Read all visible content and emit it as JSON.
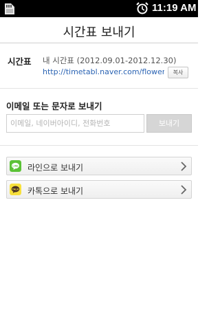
{
  "status_bar": {
    "time": "11:19 AM"
  },
  "header": {
    "title": "시간표 보내기"
  },
  "timetable": {
    "label": "시간표",
    "name": "내 시간표 (2012.09.01-2012.12.30)",
    "url": "http://timetabl.naver.com/flower",
    "copy_label": "복사"
  },
  "send": {
    "heading": "이메일 또는 문자로 보내기",
    "placeholder": "이메일, 네이버아이디, 전화번호",
    "value": "",
    "button_label": "보내기"
  },
  "share": {
    "items": [
      {
        "label": "라인으로 보내기",
        "icon": "line-app-icon",
        "icon_color": "#5bc236"
      },
      {
        "label": "카톡으로 보내기",
        "icon": "kakaotalk-icon",
        "icon_color": "#f7e03c"
      }
    ]
  },
  "colors": {
    "link": "#2a63b3",
    "status_bar_bg": "#000000",
    "disabled_button": "#d6d6d6"
  }
}
